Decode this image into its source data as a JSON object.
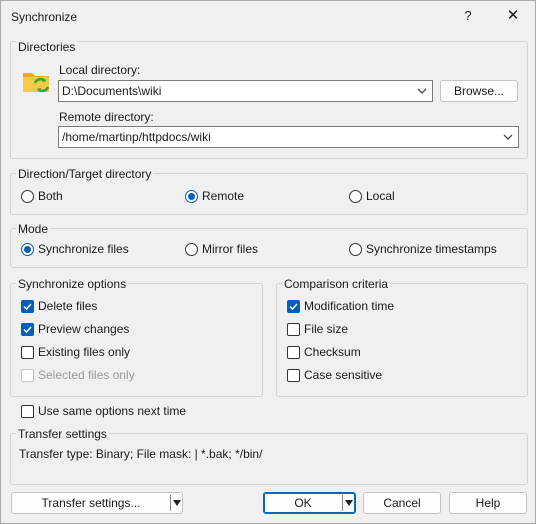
{
  "window": {
    "title": "Synchronize",
    "help_glyph": "?",
    "close_glyph": "✕"
  },
  "directories": {
    "group_label": "Directories",
    "local_label": "Local directory:",
    "local_value": "D:\\Documents\\wiki",
    "browse_label": "Browse...",
    "remote_label": "Remote directory:",
    "remote_value": "/home/martinp/httpdocs/wiki",
    "icon": "folder-sync-icon"
  },
  "direction": {
    "group_label": "Direction/Target directory",
    "options": [
      "Both",
      "Remote",
      "Local"
    ],
    "selected": "Remote"
  },
  "mode": {
    "group_label": "Mode",
    "options": [
      "Synchronize files",
      "Mirror files",
      "Synchronize timestamps"
    ],
    "selected": "Synchronize files"
  },
  "sync_options": {
    "group_label": "Synchronize options",
    "items": [
      {
        "label": "Delete files",
        "checked": true,
        "enabled": true
      },
      {
        "label": "Preview changes",
        "checked": true,
        "enabled": true
      },
      {
        "label": "Existing files only",
        "checked": false,
        "enabled": true
      },
      {
        "label": "Selected files only",
        "checked": false,
        "enabled": false
      }
    ]
  },
  "comparison": {
    "group_label": "Comparison criteria",
    "items": [
      {
        "label": "Modification time",
        "checked": true
      },
      {
        "label": "File size",
        "checked": false
      },
      {
        "label": "Checksum",
        "checked": false
      },
      {
        "label": "Case sensitive",
        "checked": false
      }
    ]
  },
  "use_same": {
    "label": "Use same options next time",
    "checked": false
  },
  "transfer": {
    "group_label": "Transfer settings",
    "summary": "Transfer type: Binary; File mask: | *.bak; */bin/"
  },
  "buttons": {
    "transfer_settings": "Transfer settings...",
    "ok": "OK",
    "cancel": "Cancel",
    "help": "Help"
  },
  "colors": {
    "accent": "#005fb8",
    "default_button_border": "#0067c0",
    "dialog_bg": "#f0f0f0"
  }
}
